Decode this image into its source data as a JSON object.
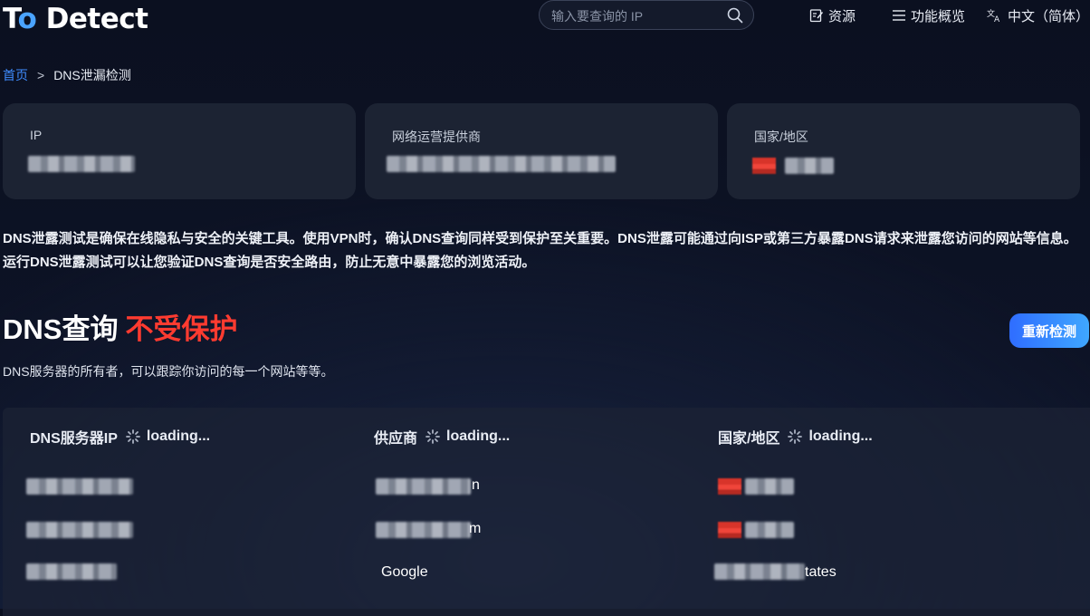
{
  "header": {
    "logo_prefix": "T",
    "logo_o": "o",
    "logo_suffix": " Detect",
    "search_placeholder": "输入要查询的 IP",
    "nav": [
      {
        "label": "资源",
        "icon": "edit-document-icon"
      },
      {
        "label": "功能概览",
        "icon": "menu-lines-icon"
      },
      {
        "label": "中文（简体）",
        "icon": "translate-icon"
      }
    ]
  },
  "breadcrumb": {
    "home": "首页",
    "separator": ">",
    "current": "DNS泄漏检测"
  },
  "cards": [
    {
      "label": "IP",
      "value": "[redacted]"
    },
    {
      "label": "网络运营提供商",
      "value": "[redacted]"
    },
    {
      "label": "国家/地区",
      "value": "[redacted]"
    }
  ],
  "description": "DNS泄露测试是确保在线隐私与安全的关键工具。使用VPN时，确认DNS查询同样受到保护至关重要。DNS泄露可能通过向ISP或第三方暴露DNS请求来泄露您访问的网站等信息。运行DNS泄露测试可以让您验证DNS查询是否安全路由，防止无意中暴露您的浏览活动。",
  "status": {
    "prefix": "DNS查询",
    "verdict": "不受保护",
    "verdict_color": "#ff3b30",
    "subtitle": "DNS服务器的所有者，可以跟踪你访问的每一个网站等等。",
    "retest_label": "重新检测"
  },
  "table": {
    "columns": [
      {
        "label": "DNS服务器IP",
        "status": "loading..."
      },
      {
        "label": "供应商",
        "status": "loading..."
      },
      {
        "label": "国家/地区",
        "status": "loading..."
      }
    ],
    "rows": [
      {
        "ip": "[redacted]",
        "provider_suffix": "n",
        "country_suffix": ""
      },
      {
        "ip": "[redacted]",
        "provider_suffix": "m",
        "country_suffix": ""
      },
      {
        "ip": "[redacted]",
        "provider": "Google",
        "country_suffix": "tates"
      }
    ]
  },
  "colors": {
    "accent_blue": "#3f8cff",
    "danger_red": "#ff3b30",
    "card_bg": "#1c2333"
  }
}
